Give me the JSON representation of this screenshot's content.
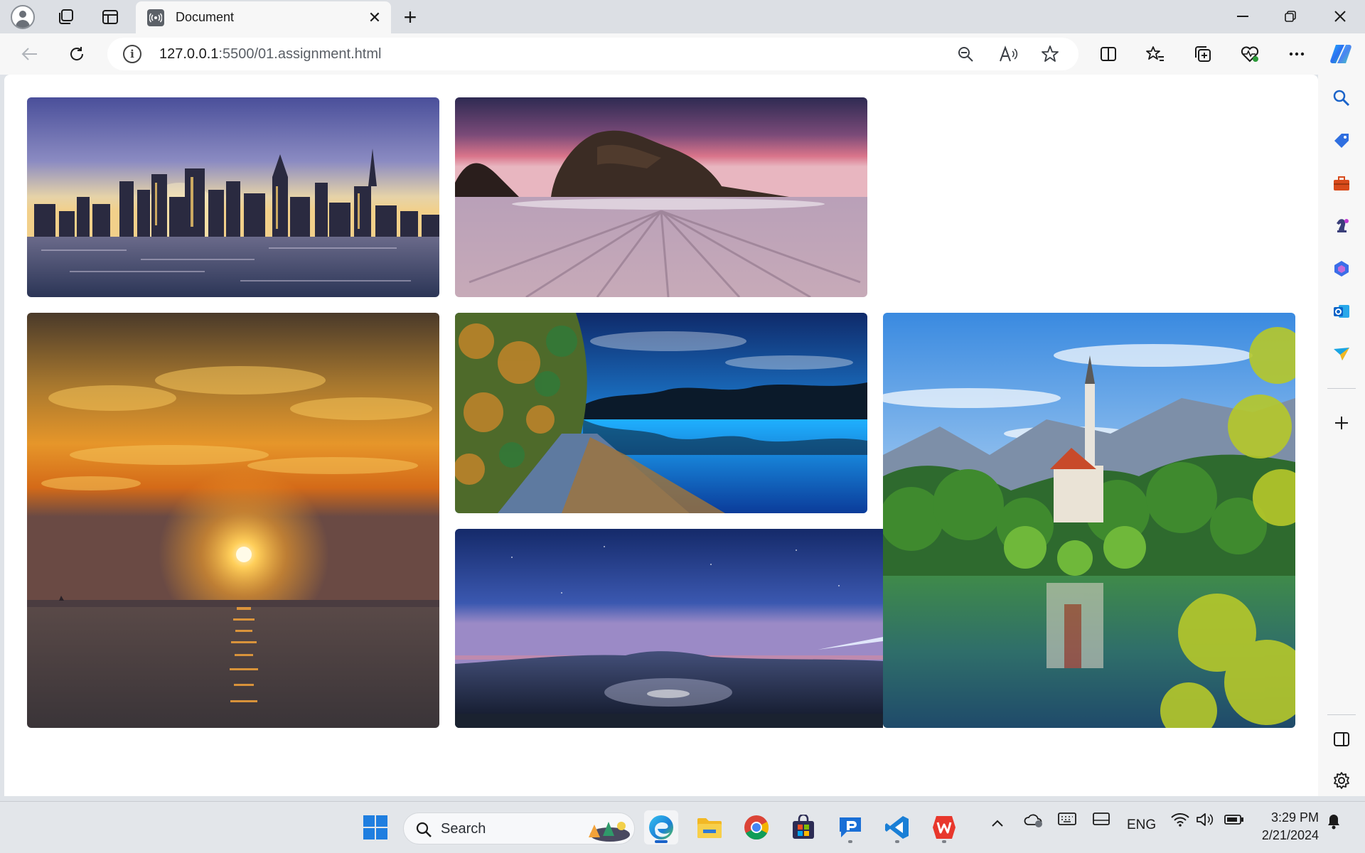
{
  "browser": {
    "tab": {
      "title": "Document",
      "favicon_glyph": "((·))",
      "close_glyph": "✕"
    },
    "new_tab_glyph": "+",
    "window_controls": {
      "minimize": "—",
      "restore": "❐",
      "close": "✕"
    },
    "address": {
      "host": "127.0.0.1",
      "path": ":5500/01.assignment.html",
      "info_glyph": "i"
    },
    "nav": {
      "back": "←",
      "refresh": "↻"
    },
    "address_actions": {
      "zoom": "⊖",
      "read_aloud": "A",
      "favorite": "☆"
    },
    "toolbar": {
      "split": "◫",
      "favorites": "☆",
      "collections": "⧉",
      "performance": "♡",
      "more": "···",
      "copilot": "◆"
    }
  },
  "sidebar": {
    "items": [
      {
        "name": "search",
        "glyph": "🔍",
        "color": "#1a63c9"
      },
      {
        "name": "shopping",
        "glyph": "◆",
        "color": "#2f6fe0"
      },
      {
        "name": "tools",
        "glyph": "■",
        "color": "#d84a1b"
      },
      {
        "name": "games",
        "glyph": "♞",
        "color": "#7a3fb0"
      },
      {
        "name": "microsoft-365",
        "glyph": "⬡",
        "color": "#3b6ee8"
      },
      {
        "name": "outlook",
        "glyph": "O",
        "color": "#0a64c8"
      },
      {
        "name": "drop",
        "glyph": "➤",
        "color": "#1aa5e3"
      }
    ],
    "add_glyph": "+",
    "panel_glyph": "▯",
    "settings_glyph": "⚙"
  },
  "gallery": {
    "images": [
      {
        "name": "city-skyline-photo"
      },
      {
        "name": "rock-beach-sunset-photo"
      },
      {
        "name": "ocean-sunset-photo"
      },
      {
        "name": "autumn-lake-path-photo"
      },
      {
        "name": "lake-bled-church-photo"
      },
      {
        "name": "night-valley-comet-photo"
      }
    ]
  },
  "taskbar": {
    "search_placeholder": "Search",
    "tray": {
      "language": "ENG"
    },
    "clock": {
      "time": "3:29 PM",
      "date": "2/21/2024"
    }
  }
}
